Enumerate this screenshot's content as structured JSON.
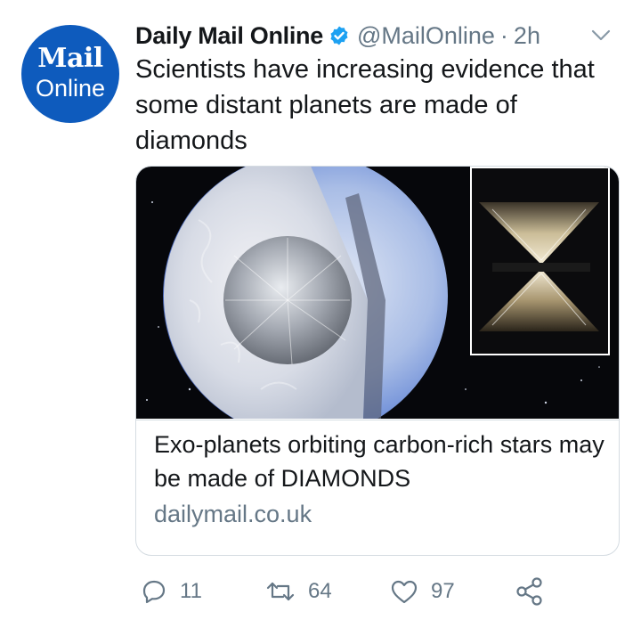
{
  "colors": {
    "brand_blue": "#0e5bbd",
    "verified_blue": "#1da1f2",
    "muted": "#657786"
  },
  "avatar": {
    "line1": "Mail",
    "line2": "Online"
  },
  "tweet": {
    "author_name": "Daily Mail Online",
    "handle": "@MailOnline",
    "separator": "·",
    "time": "2h",
    "text": "Scientists have increasing evidence that some distant planets are made of diamonds"
  },
  "card": {
    "title": "Exo-planets orbiting carbon-rich stars may be made of DIAMONDS",
    "domain": "dailymail.co.uk"
  },
  "actions": {
    "reply_count": "11",
    "retweet_count": "64",
    "like_count": "97"
  },
  "icons": [
    "verified-badge-icon",
    "chevron-down-icon",
    "reply-icon",
    "retweet-icon",
    "like-icon",
    "share-icon"
  ]
}
